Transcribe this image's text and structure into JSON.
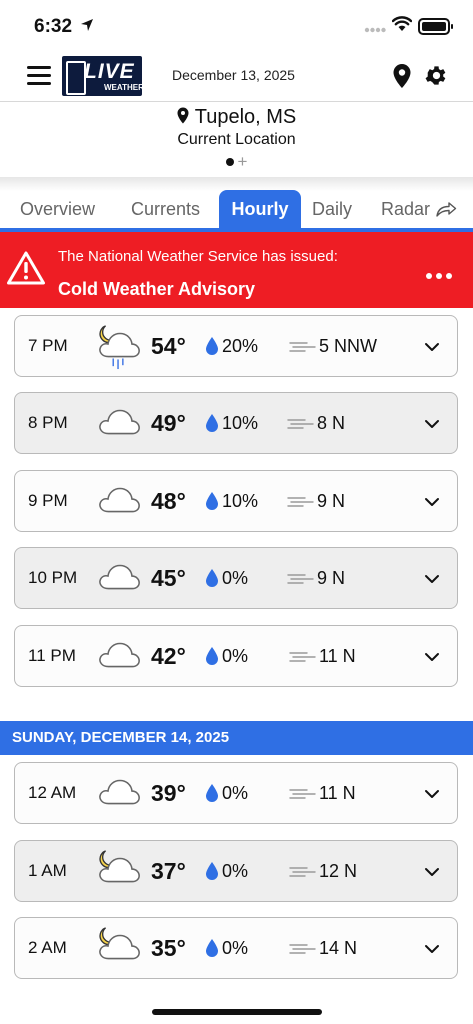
{
  "status_bar": {
    "time": "6:32"
  },
  "header": {
    "logo_text": "LIVE",
    "logo_subtext": "WEATHER",
    "date": "December 13, 2025"
  },
  "location": {
    "name": "Tupelo, MS",
    "subtitle": "Current Location"
  },
  "tabs": [
    {
      "label": "Overview",
      "active": false
    },
    {
      "label": "Currents",
      "active": false
    },
    {
      "label": "Hourly",
      "active": true
    },
    {
      "label": "Daily",
      "active": false
    },
    {
      "label": "Radar",
      "active": false
    }
  ],
  "alert": {
    "line1": "The National Weather Service has issued:",
    "title": "Cold Weather Advisory",
    "color": "#ee1d24"
  },
  "accent_color": "#2f6fe4",
  "hours": [
    {
      "time": "7 PM",
      "icon": "partly-cloudy-night-rain-icon",
      "temp": "54°",
      "precip": "20%",
      "wind": "5 NNW"
    },
    {
      "time": "8 PM",
      "icon": "cloud-icon",
      "temp": "49°",
      "precip": "10%",
      "wind": "8 N"
    },
    {
      "time": "9 PM",
      "icon": "cloud-icon",
      "temp": "48°",
      "precip": "10%",
      "wind": "9 N"
    },
    {
      "time": "10 PM",
      "icon": "cloud-icon",
      "temp": "45°",
      "precip": "0%",
      "wind": "9 N"
    },
    {
      "time": "11 PM",
      "icon": "cloud-icon",
      "temp": "42°",
      "precip": "0%",
      "wind": "11 N"
    }
  ],
  "day_header": "SUNDAY, DECEMBER 14, 2025",
  "next_day_hours": [
    {
      "time": "12 AM",
      "icon": "cloud-icon",
      "temp": "39°",
      "precip": "0%",
      "wind": "11 N"
    },
    {
      "time": "1 AM",
      "icon": "partly-cloudy-night-icon",
      "temp": "37°",
      "precip": "0%",
      "wind": "12 N"
    },
    {
      "time": "2 AM",
      "icon": "partly-cloudy-night-icon",
      "temp": "35°",
      "precip": "0%",
      "wind": "14 N"
    }
  ]
}
